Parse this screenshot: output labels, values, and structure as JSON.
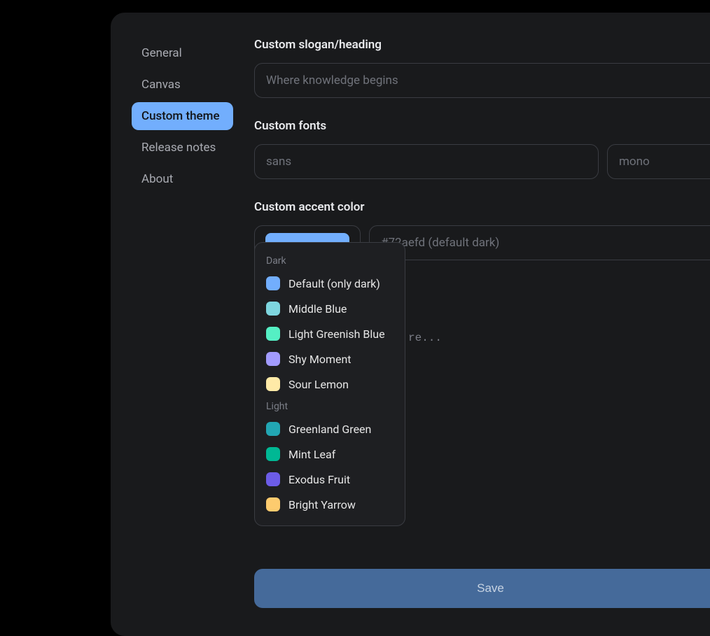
{
  "sidebar": {
    "items": [
      {
        "label": "General",
        "active": false
      },
      {
        "label": "Canvas",
        "active": false
      },
      {
        "label": "Custom theme",
        "active": true
      },
      {
        "label": "Release notes",
        "active": false
      },
      {
        "label": "About",
        "active": false
      }
    ]
  },
  "sections": {
    "slogan": {
      "heading": "Custom slogan/heading",
      "placeholder": "Where knowledge begins",
      "value": ""
    },
    "fonts": {
      "heading": "Custom fonts",
      "sans_placeholder": "sans",
      "sans_value": "",
      "mono_placeholder": "mono",
      "mono_value": ""
    },
    "accent": {
      "heading": "Custom accent color",
      "swatch_color": "#72aefd",
      "placeholder": "#72aefd (default dark)",
      "value": ""
    },
    "css": {
      "hint": "re..."
    }
  },
  "dropdown": {
    "groups": [
      {
        "label": "Dark",
        "items": [
          {
            "color": "#72aefd",
            "name": "Default (only dark)"
          },
          {
            "color": "#7ed6df",
            "name": "Middle Blue"
          },
          {
            "color": "#55efc4",
            "name": "Light Greenish Blue"
          },
          {
            "color": "#a29bfe",
            "name": "Shy Moment"
          },
          {
            "color": "#ffeaa7",
            "name": "Sour Lemon"
          }
        ]
      },
      {
        "label": "Light",
        "items": [
          {
            "color": "#22a6b3",
            "name": "Greenland Green"
          },
          {
            "color": "#00b894",
            "name": "Mint Leaf"
          },
          {
            "color": "#6c5ce7",
            "name": "Exodus Fruit"
          },
          {
            "color": "#fdcb6e",
            "name": "Bright Yarrow"
          }
        ]
      }
    ]
  },
  "footer": {
    "save_label": "Save"
  }
}
